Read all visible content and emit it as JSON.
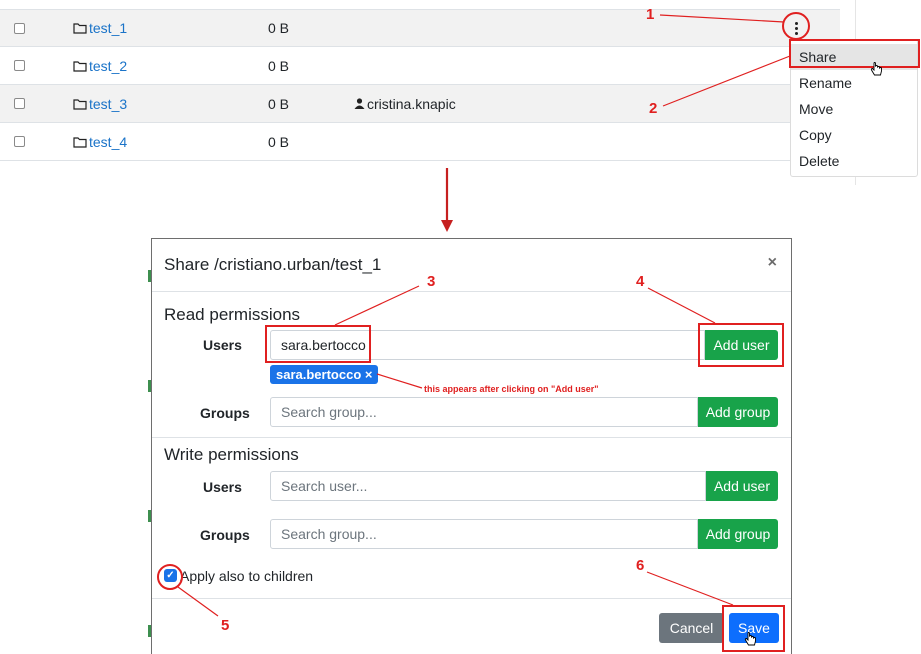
{
  "files": [
    {
      "name": "test_1",
      "size": "0 B",
      "owner": ""
    },
    {
      "name": "test_2",
      "size": "0 B",
      "owner": ""
    },
    {
      "name": "test_3",
      "size": "0 B",
      "owner": "cristina.knapic"
    },
    {
      "name": "test_4",
      "size": "0 B",
      "owner": ""
    }
  ],
  "context_menu": {
    "items": [
      "Share",
      "Rename",
      "Move",
      "Copy",
      "Delete"
    ],
    "active": "Share"
  },
  "modal": {
    "title": "Share /cristiano.urban/test_1",
    "close_label": "×",
    "read_permissions": {
      "title": "Read permissions",
      "users_label": "Users",
      "users_value": "sara.bertocco",
      "add_user_label": "Add user",
      "user_tag": "sara.bertocco ×",
      "groups_label": "Groups",
      "groups_placeholder": "Search group...",
      "add_group_label": "Add group"
    },
    "write_permissions": {
      "title": "Write permissions",
      "users_label": "Users",
      "users_placeholder": "Search user...",
      "add_user_label": "Add user",
      "groups_label": "Groups",
      "groups_placeholder": "Search group...",
      "add_group_label": "Add group"
    },
    "apply_children_label": "Apply also to children",
    "apply_children_checked": true,
    "cancel_label": "Cancel",
    "save_label": "Save"
  },
  "annotations": {
    "numbers": [
      "1",
      "2",
      "3",
      "4",
      "5",
      "6"
    ],
    "note": "this appears after clicking on \"Add user\""
  },
  "colors": {
    "link": "#1a73c8",
    "annotation": "#e02020",
    "success": "#18a34a",
    "primary": "#0d6efd",
    "secondary": "#6c757d"
  }
}
